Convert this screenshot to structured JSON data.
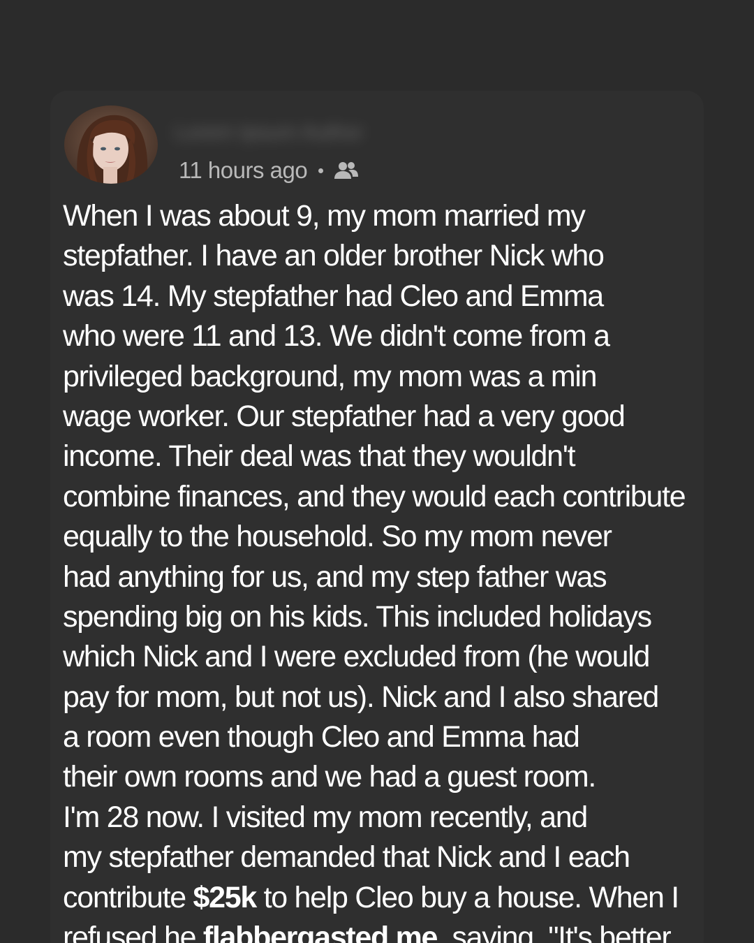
{
  "post": {
    "author_name": "Lorem Ipsum Author",
    "timestamp": "11 hours ago",
    "separator": "•",
    "audience_icon": "friends-icon",
    "lines": [
      [
        {
          "t": "When I was about 9, my mom married my"
        }
      ],
      [
        {
          "t": "stepfather. I have an older brother Nick who"
        }
      ],
      [
        {
          "t": "was 14. My stepfather had Cleo and Emma"
        }
      ],
      [
        {
          "t": "who were 11 and 13. We didn't come from a"
        }
      ],
      [
        {
          "t": "privileged background, my mom was a min"
        }
      ],
      [
        {
          "t": "wage worker. Our stepfather had a very good"
        }
      ],
      [
        {
          "t": "income. Their deal was that they wouldn't"
        }
      ],
      [
        {
          "t": "combine finances, and they would each contribute"
        }
      ],
      [
        {
          "t": "equally to the household. So my mom never"
        }
      ],
      [
        {
          "t": "had anything for us, and my step father was"
        }
      ],
      [
        {
          "t": "spending big on his kids. This included holidays"
        }
      ],
      [
        {
          "t": "which Nick and I were excluded from (he would"
        }
      ],
      [
        {
          "t": "pay for mom, but not us). Nick and I also shared"
        }
      ],
      [
        {
          "t": "a room even though Cleo and Emma had"
        }
      ],
      [
        {
          "t": "their own rooms and we had a guest room."
        }
      ],
      [
        {
          "t": "I'm 28 now. I visited my mom recently, and"
        }
      ],
      [
        {
          "t": "my stepfather demanded that Nick and I each"
        }
      ],
      [
        {
          "t": "contribute "
        },
        {
          "t": "$25k",
          "b": true
        },
        {
          "t": " to help Cleo buy a house. When I"
        }
      ],
      [
        {
          "t": "refused he "
        },
        {
          "t": "flabbergasted me",
          "b": true
        },
        {
          "t": ", saying, \"It's better"
        }
      ]
    ]
  },
  "colors": {
    "background": "#2b2b2b",
    "card": "#2f2f2f",
    "text": "#ffffff",
    "meta_text": "#b9b9b9"
  }
}
